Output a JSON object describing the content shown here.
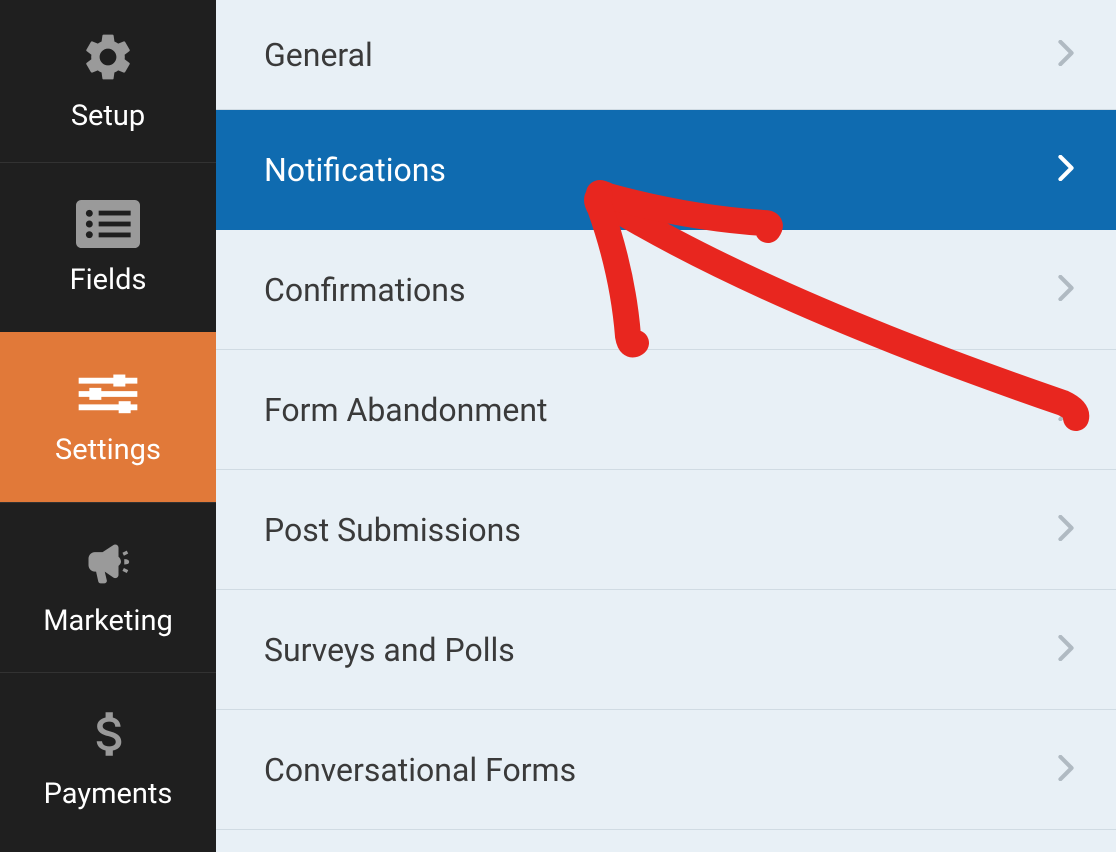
{
  "sidebar": {
    "items": [
      {
        "label": "Setup",
        "icon": "gear-icon",
        "active": false
      },
      {
        "label": "Fields",
        "icon": "list-icon",
        "active": false
      },
      {
        "label": "Settings",
        "icon": "sliders-icon",
        "active": true
      },
      {
        "label": "Marketing",
        "icon": "bullhorn-icon",
        "active": false
      },
      {
        "label": "Payments",
        "icon": "dollar-icon",
        "active": false
      }
    ]
  },
  "settings": {
    "items": [
      {
        "label": "General",
        "active": false
      },
      {
        "label": "Notifications",
        "active": true
      },
      {
        "label": "Confirmations",
        "active": false
      },
      {
        "label": "Form Abandonment",
        "active": false
      },
      {
        "label": "Post Submissions",
        "active": false
      },
      {
        "label": "Surveys and Polls",
        "active": false
      },
      {
        "label": "Conversational Forms",
        "active": false
      }
    ]
  },
  "colors": {
    "sidebar_bg": "#1f1f1f",
    "sidebar_active": "#E17939",
    "list_bg": "#e8f0f6",
    "list_active": "#0f6bb0",
    "annotation": "#e8261f"
  }
}
